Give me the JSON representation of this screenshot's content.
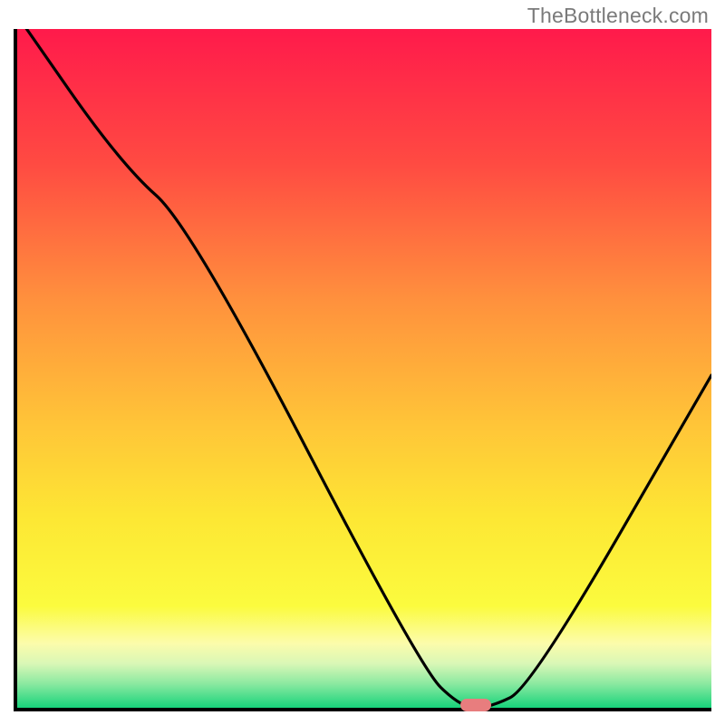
{
  "watermark": "TheBottleneck.com",
  "chart_data": {
    "type": "line",
    "title": "",
    "xlabel": "",
    "ylabel": "",
    "xlim": [
      0,
      100
    ],
    "ylim": [
      0,
      100
    ],
    "x": [
      0,
      15,
      25,
      58,
      64,
      68,
      74,
      100
    ],
    "values": [
      102,
      80,
      71,
      6,
      0,
      0,
      3,
      49
    ],
    "marker": {
      "x": 66,
      "y": 0
    },
    "gradient_stops": [
      {
        "pos": 0.0,
        "color": "#ff1a4b"
      },
      {
        "pos": 0.2,
        "color": "#ff4b42"
      },
      {
        "pos": 0.4,
        "color": "#ff913d"
      },
      {
        "pos": 0.58,
        "color": "#ffc438"
      },
      {
        "pos": 0.72,
        "color": "#fde734"
      },
      {
        "pos": 0.85,
        "color": "#fbfb3e"
      },
      {
        "pos": 0.905,
        "color": "#fcfcab"
      },
      {
        "pos": 0.935,
        "color": "#d9f7b6"
      },
      {
        "pos": 0.965,
        "color": "#8ae9a0"
      },
      {
        "pos": 1.0,
        "color": "#17d37b"
      }
    ]
  }
}
